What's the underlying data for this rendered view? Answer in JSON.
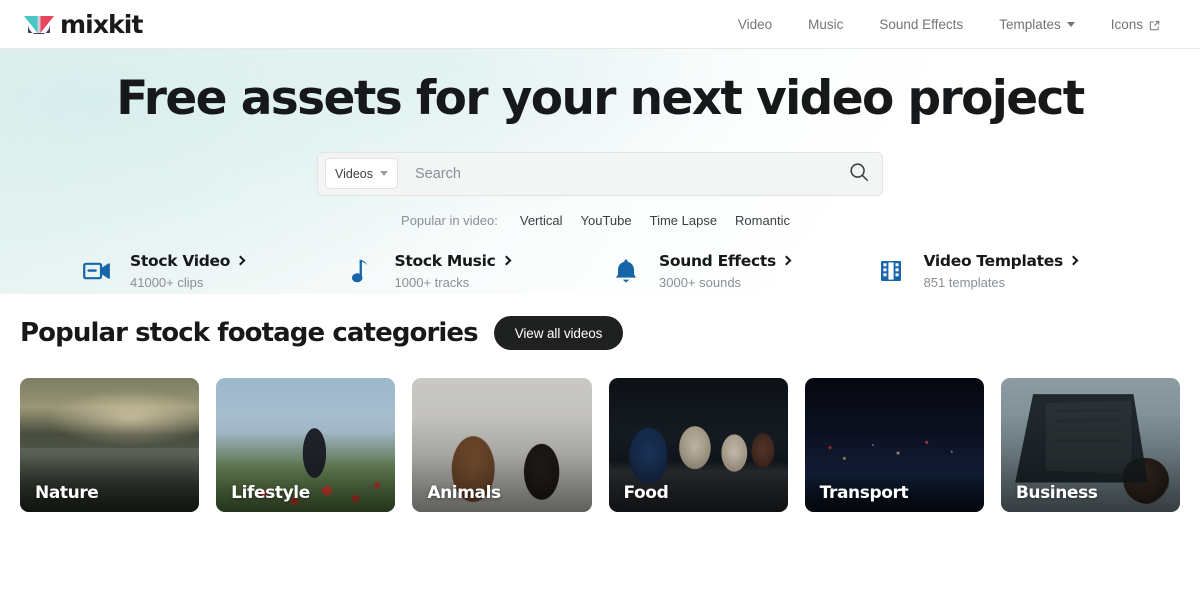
{
  "brand": {
    "name": "mixkit",
    "logo_colors": [
      "#4bc6c6",
      "#e8455f",
      "#3b2a5a"
    ]
  },
  "header": {
    "nav": [
      {
        "label": "Video",
        "icon": null
      },
      {
        "label": "Music",
        "icon": null
      },
      {
        "label": "Sound Effects",
        "icon": null
      },
      {
        "label": "Templates",
        "icon": "chevron-down-icon"
      },
      {
        "label": "Icons",
        "icon": "external-link-icon"
      }
    ]
  },
  "hero": {
    "title": "Free assets for your next video project",
    "search": {
      "type_selector": "Videos",
      "type_caret": "chevron-down-icon",
      "placeholder": "Search",
      "value": "",
      "submit_icon": "search-icon"
    },
    "popular": {
      "label": "Popular in video:",
      "tags": [
        "Vertical",
        "YouTube",
        "Time Lapse",
        "Romantic"
      ]
    },
    "quick_links": [
      {
        "icon": "video-camera-icon",
        "title": "Stock Video",
        "count": "41000+ clips",
        "chevron": "chevron-right-icon"
      },
      {
        "icon": "music-note-icon",
        "title": "Stock Music",
        "count": "1000+ tracks",
        "chevron": "chevron-right-icon"
      },
      {
        "icon": "bell-icon",
        "title": "Sound Effects",
        "count": "3000+ sounds",
        "chevron": "chevron-right-icon"
      },
      {
        "icon": "film-strip-icon",
        "title": "Video Templates",
        "count": "851 templates",
        "chevron": "chevron-right-icon"
      }
    ],
    "icon_color": "#1565a8"
  },
  "categories": {
    "heading": "Popular stock footage categories",
    "view_all_label": "View all videos",
    "view_all_color": "#1f2121",
    "cards": [
      {
        "label": "Nature",
        "art": "art-nature"
      },
      {
        "label": "Lifestyle",
        "art": "art-lifestyle"
      },
      {
        "label": "Animals",
        "art": "art-animals"
      },
      {
        "label": "Food",
        "art": "art-food"
      },
      {
        "label": "Transport",
        "art": "art-transport"
      },
      {
        "label": "Business",
        "art": "art-business"
      }
    ]
  }
}
